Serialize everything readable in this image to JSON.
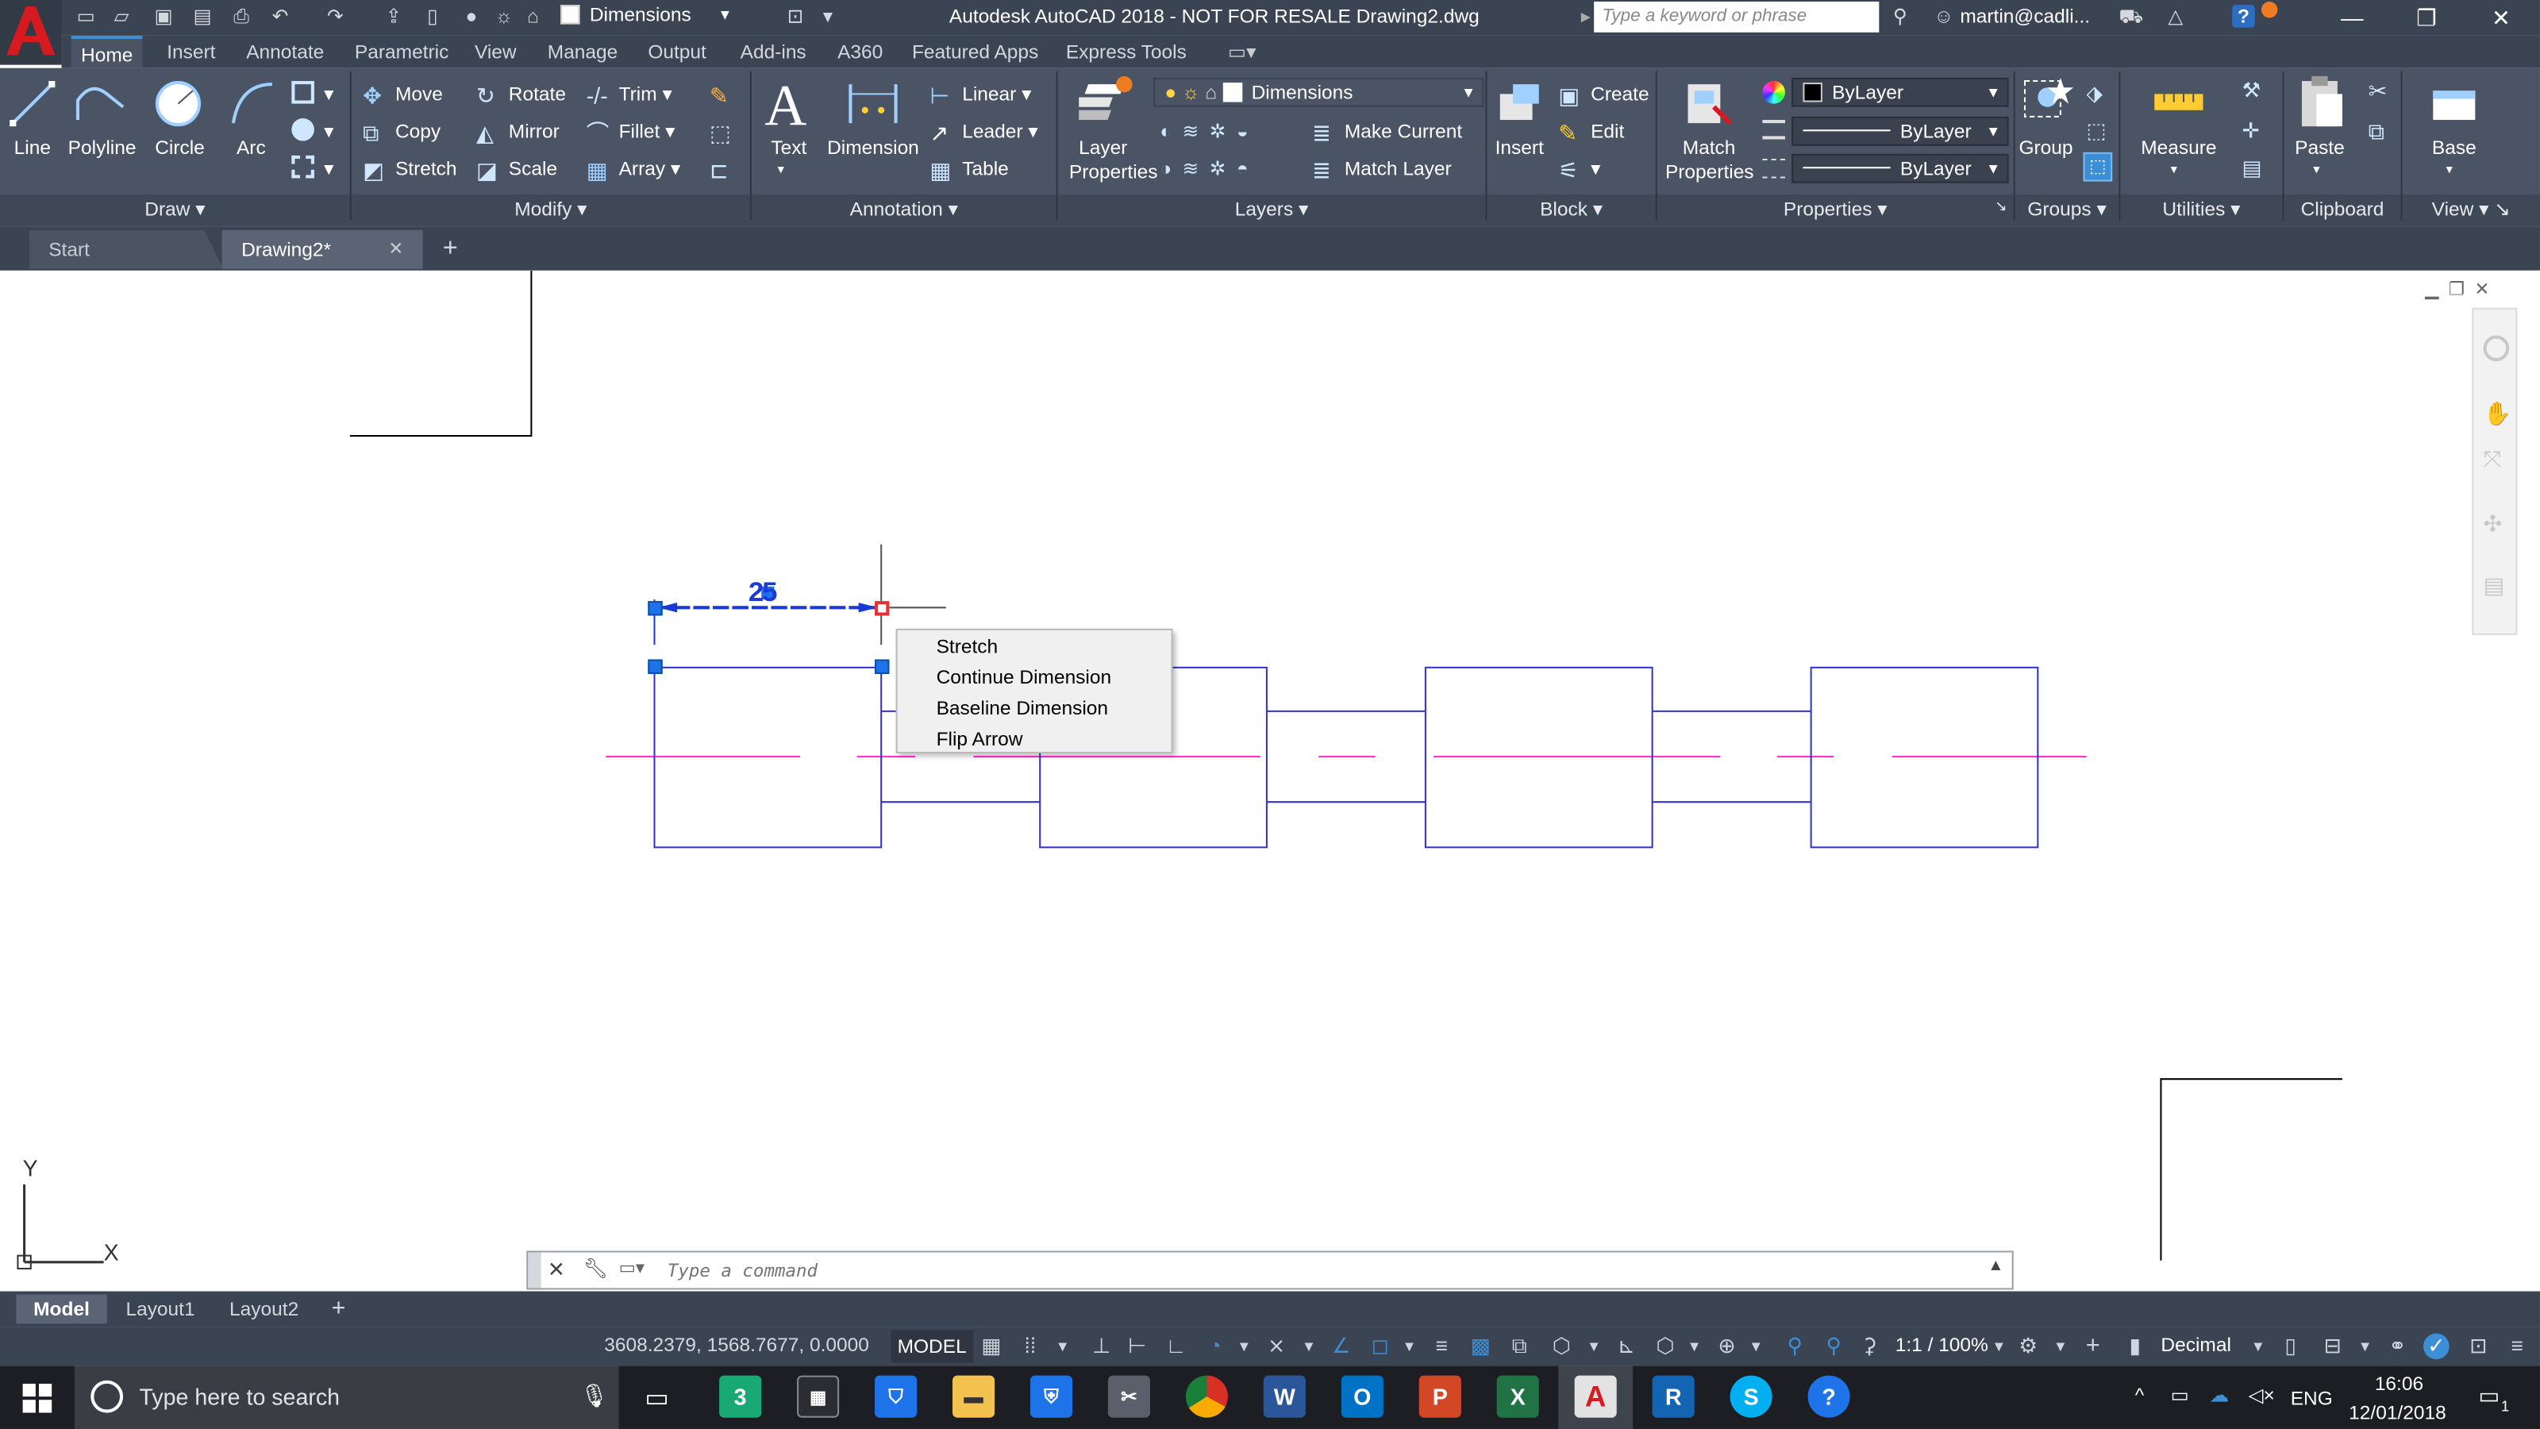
{
  "titlebar": {
    "dimension_style": "Dimensions",
    "title": "Autodesk AutoCAD 2018 - NOT FOR RESALE    Drawing2.dwg",
    "search_placeholder": "Type a keyword or phrase",
    "user": "martin@cadli...",
    "help": "?"
  },
  "ribbon_tabs": [
    "Home",
    "Insert",
    "Annotate",
    "Parametric",
    "View",
    "Manage",
    "Output",
    "Add-ins",
    "A360",
    "Featured Apps",
    "Express Tools"
  ],
  "ribbon": {
    "draw": {
      "title": "Draw",
      "line": "Line",
      "polyline": "Polyline",
      "circle": "Circle",
      "arc": "Arc"
    },
    "modify": {
      "title": "Modify",
      "move": "Move",
      "rotate": "Rotate",
      "trim": "Trim",
      "copy": "Copy",
      "mirror": "Mirror",
      "fillet": "Fillet",
      "stretch": "Stretch",
      "scale": "Scale",
      "array": "Array"
    },
    "annotation": {
      "title": "Annotation",
      "text": "Text",
      "dimension": "Dimension",
      "linear": "Linear",
      "leader": "Leader",
      "table": "Table"
    },
    "layers": {
      "title": "Layers",
      "layer_properties_1": "Layer",
      "layer_properties_2": "Properties",
      "current_layer": "Dimensions",
      "make_current": "Make Current",
      "match_layer": "Match Layer"
    },
    "block": {
      "title": "Block",
      "insert": "Insert",
      "create": "Create",
      "edit": "Edit"
    },
    "properties": {
      "title": "Properties",
      "match_1": "Match",
      "match_2": "Properties",
      "color": "ByLayer",
      "linetype": "ByLayer",
      "lineweight": "ByLayer"
    },
    "groups": {
      "title": "Groups",
      "group": "Group"
    },
    "utilities": {
      "title": "Utilities",
      "measure": "Measure"
    },
    "clipboard": {
      "title": "Clipboard",
      "paste": "Paste"
    },
    "view": {
      "title": "View",
      "base": "Base"
    }
  },
  "file_tabs": {
    "start": "Start",
    "active": "Drawing2*"
  },
  "drawing": {
    "dimension_text": "25",
    "context_menu": [
      "Stretch",
      "Continue Dimension",
      "Baseline Dimension",
      "Flip Arrow"
    ],
    "ucs_y": "Y",
    "ucs_x": "X"
  },
  "command_line": {
    "placeholder": "Type a command"
  },
  "layout_tabs": [
    "Model",
    "Layout1",
    "Layout2"
  ],
  "status_bar": {
    "coordinates": "3608.2379, 1568.7677, 0.0000",
    "space": "MODEL",
    "scale": "1:1 / 100%",
    "units": "Decimal"
  },
  "taskbar": {
    "search_placeholder": "Type here to search",
    "language": "ENG",
    "time": "16:06",
    "date": "12/01/2018",
    "notifications": "1"
  },
  "colors": {
    "chrome": "#3b4453",
    "ribbon": "#4a5464",
    "geometry_blue": "#3333cc",
    "centerline_magenta": "#ff33cc",
    "grip_blue": "#1e73e8",
    "grip_hot": "#e83030"
  }
}
